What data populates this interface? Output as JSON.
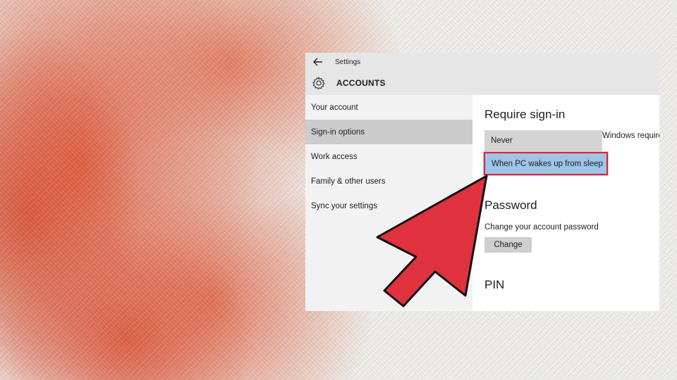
{
  "window": {
    "title": "Settings",
    "back_icon": "back-arrow-icon",
    "section": "ACCOUNTS",
    "section_icon": "gear-icon"
  },
  "sidebar": {
    "items": [
      {
        "label": "Your account"
      },
      {
        "label": "Sign-in options",
        "selected": true
      },
      {
        "label": "Work access"
      },
      {
        "label": "Family & other users"
      },
      {
        "label": "Sync your settings"
      }
    ]
  },
  "content": {
    "require_signin": {
      "heading": "Require sign-in",
      "options": [
        "Never",
        "When PC wakes up from sleep"
      ],
      "selected": "When PC wakes up from sleep",
      "side_text": "Windows require"
    },
    "password": {
      "heading": "Password",
      "description": "Change your account password",
      "button": "Change"
    },
    "pin": {
      "heading": "PIN"
    }
  },
  "colors": {
    "highlight": "#9ec4e8",
    "highlight_border": "#d0283a",
    "pointer_arrow": "#e0313f"
  }
}
